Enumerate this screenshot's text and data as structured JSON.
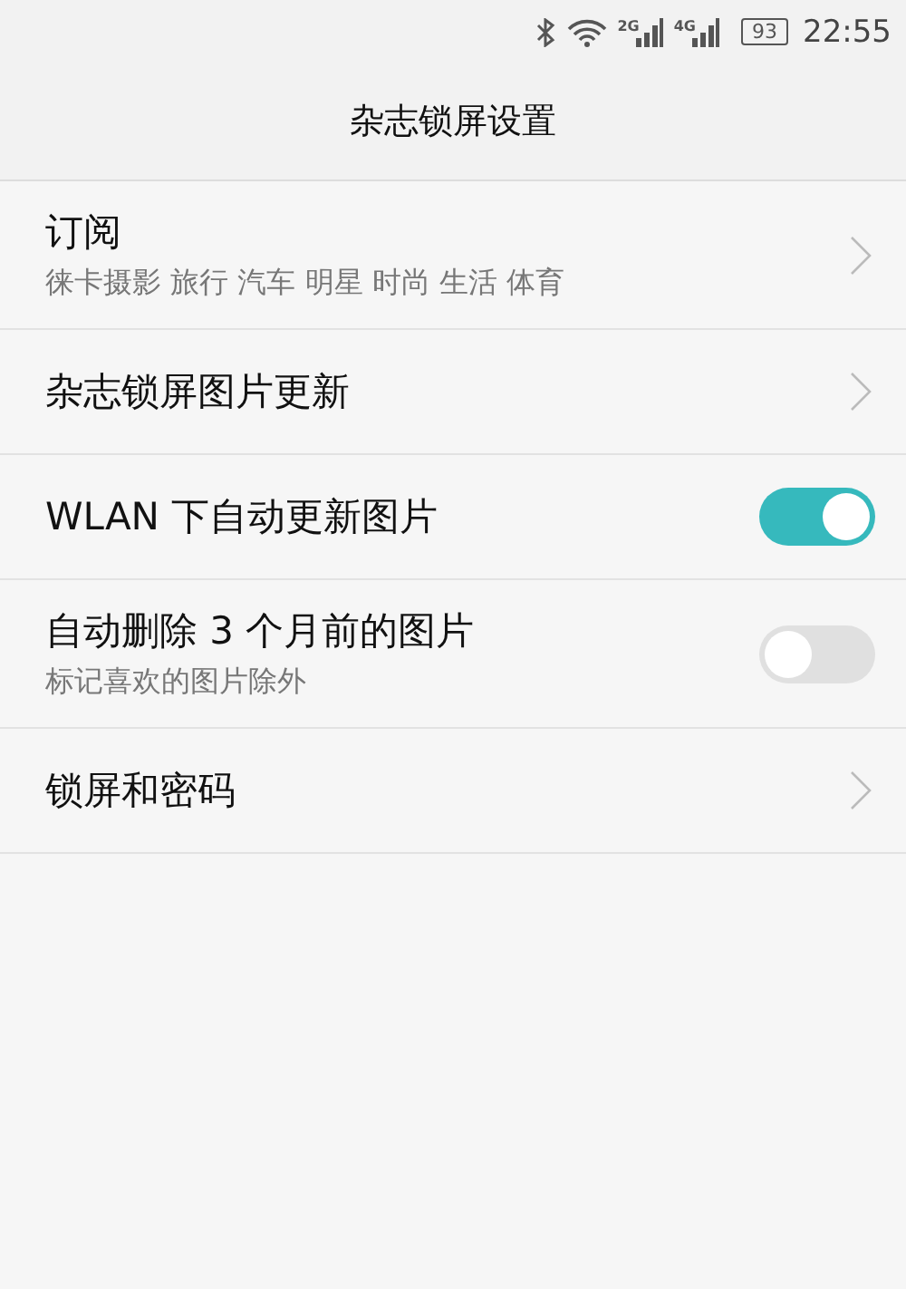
{
  "status_bar": {
    "signal_labels": [
      "2G",
      "4G"
    ],
    "battery": "93",
    "time": "22:55"
  },
  "header": {
    "title": "杂志锁屏设置"
  },
  "settings": [
    {
      "kind": "link",
      "title": "订阅",
      "subtitle": "徕卡摄影 旅行 汽车 明星 时尚 生活 体育"
    },
    {
      "kind": "link",
      "title": "杂志锁屏图片更新"
    },
    {
      "kind": "toggle",
      "title": "WLAN 下自动更新图片",
      "on": true
    },
    {
      "kind": "toggle",
      "title": "自动删除 3 个月前的图片",
      "subtitle": "标记喜欢的图片除外",
      "on": false
    },
    {
      "kind": "link",
      "title": "锁屏和密码"
    }
  ]
}
